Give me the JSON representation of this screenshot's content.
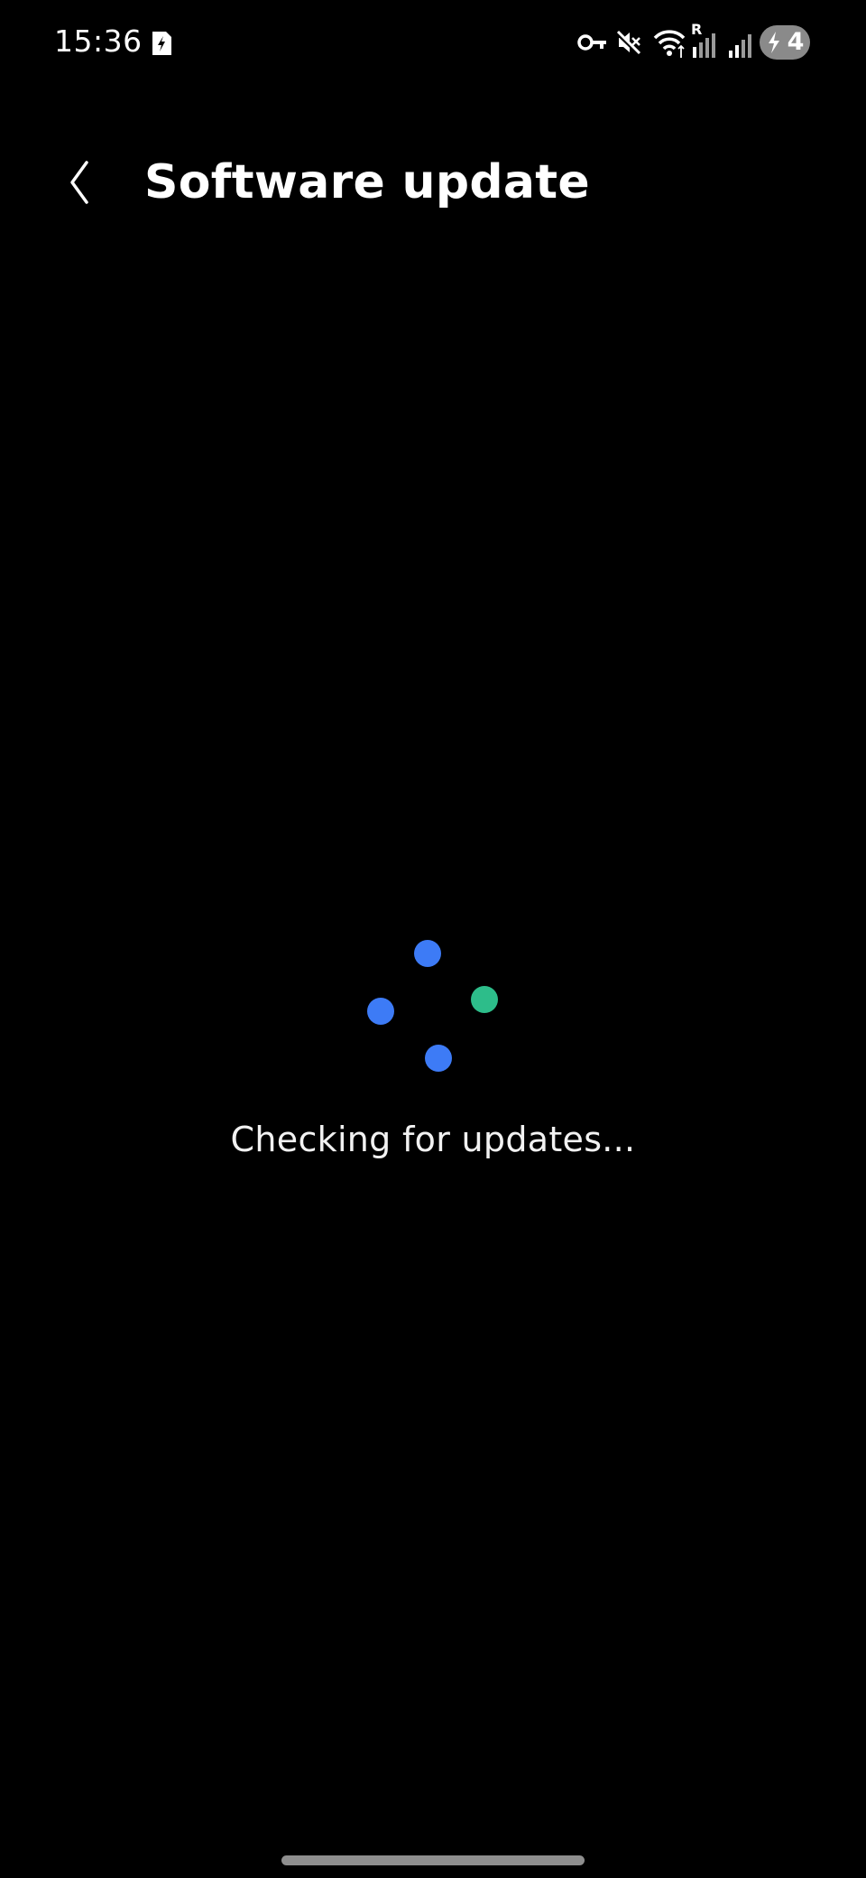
{
  "status_bar": {
    "time": "15:36",
    "icons": [
      "sim-card-icon",
      "vpn-key-icon",
      "mute-icon",
      "wifi-icon",
      "signal-roaming-icon",
      "signal-icon",
      "battery-charging-icon"
    ],
    "roaming_label": "R",
    "battery_level": "4"
  },
  "header": {
    "title": "Software update",
    "back_icon": "chevron-left-icon"
  },
  "main": {
    "status_text": "Checking for updates...",
    "spinner_colors": [
      "#3d7bf6",
      "#3d7bf6",
      "#2dbd8a",
      "#3d7bf6"
    ]
  }
}
